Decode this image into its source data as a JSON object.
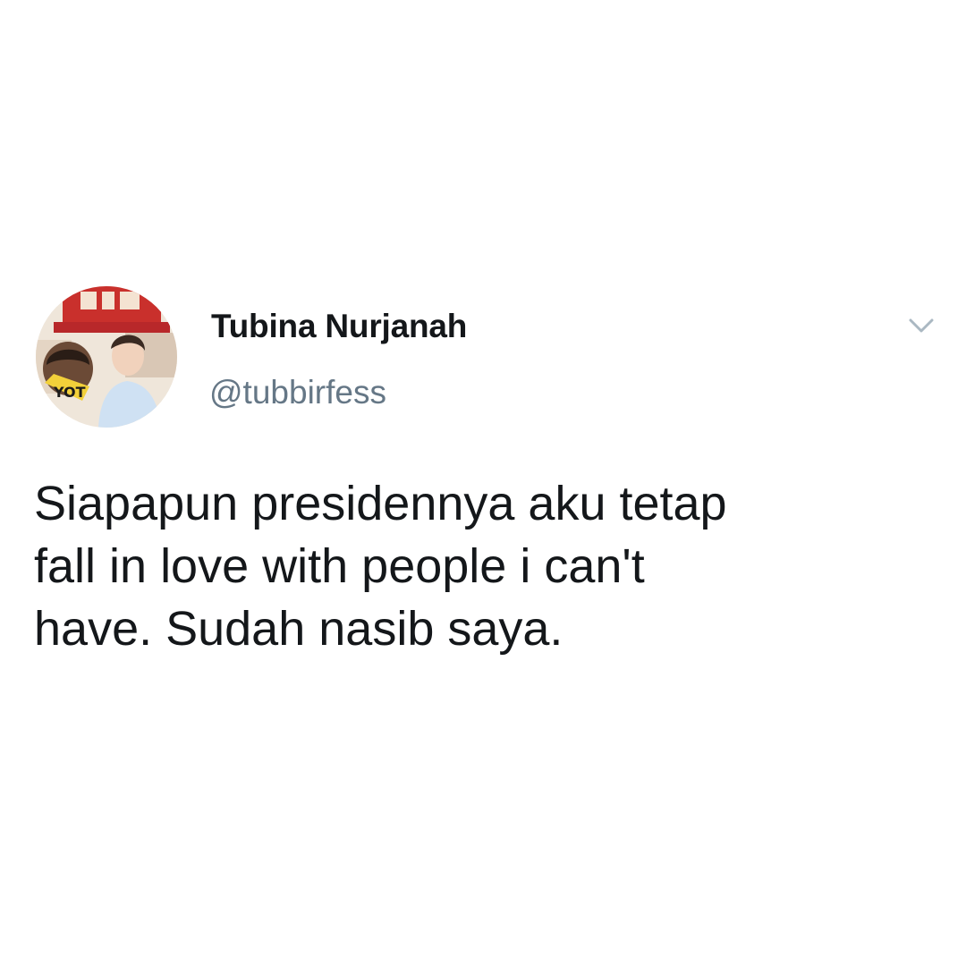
{
  "tweet": {
    "author": {
      "display_name": "Tubina Nurjanah",
      "handle": "@tubbirfess",
      "avatar_icon": "profile-photo"
    },
    "menu_icon": "chevron-down-icon",
    "text": "Siapapun presidennya aku tetap\nfall in love with people i can't\nhave. Sudah nasib saya."
  },
  "colors": {
    "name": "#14171a",
    "handle": "#657786",
    "chevron": "#aab8c2",
    "background": "#ffffff"
  }
}
